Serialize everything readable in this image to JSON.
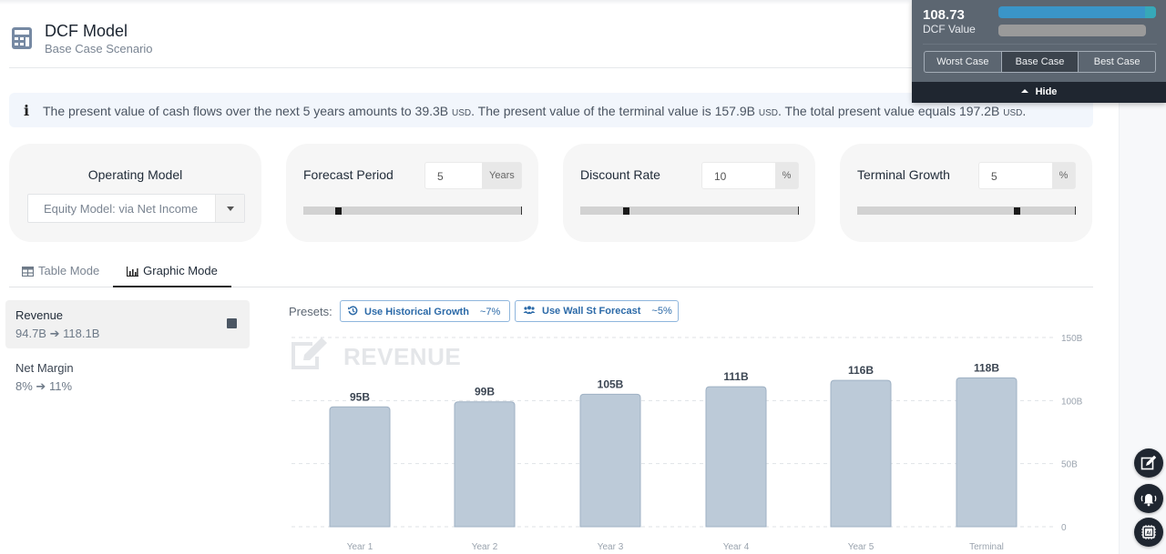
{
  "header": {
    "title": "DCF Model",
    "subtitle": "Base Case Scenario"
  },
  "info": {
    "text_1": "The present value of cash flows over the next 5 years amounts to 39.3B ",
    "currency": "USD",
    "text_2": ". The present value of the terminal value is 157.9B ",
    "text_3": ". The total present value equals 197.2B ",
    "text_4": "."
  },
  "params": {
    "operating_model": {
      "label": "Operating Model",
      "selected": "Equity Model: via Net Income"
    },
    "forecast_period": {
      "label": "Forecast Period",
      "value": "5",
      "unit": "Years",
      "slider_fraction": 0.15
    },
    "discount_rate": {
      "label": "Discount Rate",
      "value": "10",
      "unit": "%",
      "slider_fraction": 0.2
    },
    "terminal_growth": {
      "label": "Terminal Growth",
      "value": "5",
      "unit": "%",
      "slider_fraction": 0.74
    }
  },
  "tabs": {
    "table": "Table Mode",
    "graphic": "Graphic Mode",
    "active": "graphic"
  },
  "metrics": [
    {
      "name": "Revenue",
      "from": "94.7B",
      "to": "118.1B",
      "selected": true
    },
    {
      "name": "Net Margin",
      "from": "8%",
      "to": "11%",
      "selected": false
    }
  ],
  "presets": {
    "label": "Presets:",
    "historical": {
      "label": "Use Historical Growth",
      "value": "~7%"
    },
    "wallst": {
      "label": "Use Wall St Forecast",
      "value": "~5%"
    }
  },
  "chart_data": {
    "type": "bar",
    "title": "REVENUE",
    "categories": [
      "Year 1",
      "Year 2",
      "Year 3",
      "Year 4",
      "Year 5",
      "Terminal"
    ],
    "values": [
      95,
      99,
      105,
      111,
      116,
      118
    ],
    "value_labels": [
      "95B",
      "99B",
      "105B",
      "111B",
      "116B",
      "118B"
    ],
    "y_ticks": [
      0,
      50,
      100,
      150
    ],
    "y_tick_labels": [
      "0",
      "50B",
      "100B",
      "150B"
    ],
    "ylim": [
      0,
      150
    ],
    "unit": "B",
    "grid": true,
    "bar_color": "#bccad8"
  },
  "dcf_panel": {
    "value": "108.73",
    "label": "DCF Value",
    "cases": [
      "Worst Case",
      "Base Case",
      "Best Case"
    ],
    "active_case": "Base Case",
    "hide_label": "Hide"
  }
}
